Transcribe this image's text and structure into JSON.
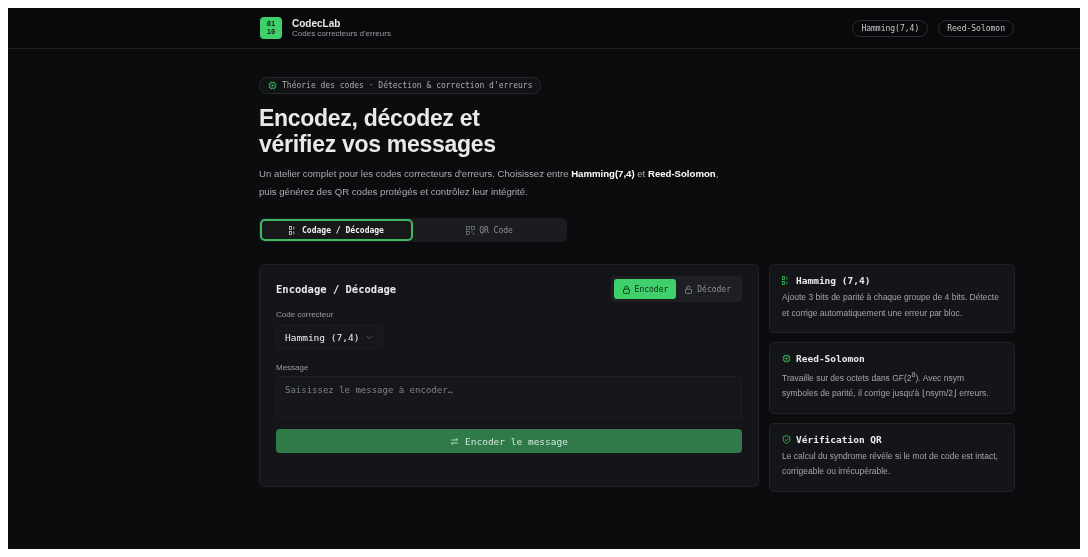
{
  "header": {
    "logo": "01\n10",
    "brand": "CodecLab",
    "tagline": "Codes correcteurs d'erreurs",
    "chips": [
      "Hamming(7,4)",
      "Reed-Solomon"
    ]
  },
  "hero": {
    "badge": "Théorie des codes · Détection & correction d'erreurs",
    "title": "Encodez, décodez et\nvérifiez vos messages",
    "lead": "Un atelier complet pour les codes correcteurs d'erreurs. Choisissez entre **Hamming(7,4)** et **Reed-Solomon**, puis générez des QR codes protégés et contrôlez leur intégrité."
  },
  "tabs": [
    {
      "label": "Codage / Décodage",
      "kind": "code",
      "selected": true
    },
    {
      "label": "QR Code",
      "kind": "qr",
      "selected": false
    }
  ],
  "panel": {
    "title": "Encodage / Décodage",
    "modes": [
      {
        "label": "Encoder",
        "kind": "lock",
        "selected": true
      },
      {
        "label": "Décoder",
        "kind": "unlock",
        "selected": false
      }
    ],
    "code_label": "Code correcteur",
    "code_value": "Hamming (7,4)",
    "message_label": "Message",
    "message_placeholder": "Saisissez le message à encoder…",
    "submit": "Encoder le message"
  },
  "info_cards": [
    {
      "kind": "binary",
      "title": "Hamming (7,4)",
      "text": "Ajoute 3 bits de parité à chaque groupe de 4 bits. Détecte et corrige automatiquement une erreur par bloc."
    },
    {
      "kind": "chip",
      "title": "Reed-Solomon",
      "text": "Travaille sur des octets dans GF(2$^{8}$). Avec nsym symboles de parité, il corrige jusqu'à ⌊nsym/2⌋ erreurs."
    },
    {
      "kind": "shield",
      "title": "Vérification QR",
      "text": "Le calcul du syndrome révèle si le mot de code est intact, corrigeable ou irrécupérable."
    }
  ]
}
